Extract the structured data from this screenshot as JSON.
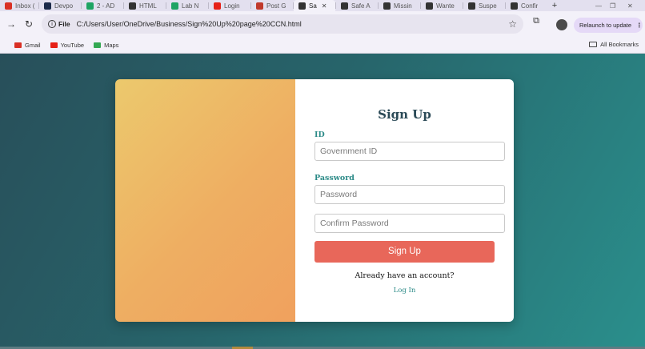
{
  "browser": {
    "tabs": [
      {
        "label": "Inbox (",
        "icon": "gmail-icon",
        "color": "#d93025"
      },
      {
        "label": "Devpo",
        "icon": "devpost-icon",
        "color": "#1b2a4a"
      },
      {
        "label": "2 - AD",
        "icon": "drive-icon",
        "color": "#1fa463"
      },
      {
        "label": "HTML",
        "icon": "chatgpt-icon",
        "color": "#333333"
      },
      {
        "label": "Lab N",
        "icon": "drive-icon",
        "color": "#1fa463"
      },
      {
        "label": "Login",
        "icon": "youtube-icon",
        "color": "#e62117"
      },
      {
        "label": "Post G",
        "icon": "flag-icon",
        "color": "#c0392b"
      },
      {
        "label": "Sa",
        "icon": "chatgpt-icon",
        "color": "#333333",
        "active": true
      },
      {
        "label": "Safe A",
        "icon": "chatgpt-icon",
        "color": "#333333"
      },
      {
        "label": "Missin",
        "icon": "chatgpt-icon",
        "color": "#333333"
      },
      {
        "label": "Wante",
        "icon": "chatgpt-icon",
        "color": "#333333"
      },
      {
        "label": "Suspe",
        "icon": "chatgpt-icon",
        "color": "#333333"
      },
      {
        "label": "Confir",
        "icon": "chatgpt-icon",
        "color": "#333333"
      }
    ],
    "close_glyph": "✕",
    "new_tab_glyph": "+",
    "window_controls": {
      "minimize": "—",
      "restore": "❐",
      "close": "✕"
    },
    "scheme": "File",
    "url": "C:/Users/User/OneDrive/Business/Sign%20Up%20page%20CCN.html",
    "relaunch_label": "Relaunch to update",
    "relaunch_menu": "⋮",
    "bookmarks": [
      {
        "label": "Gmail",
        "icon": "gmail-icon",
        "color": "#d93025"
      },
      {
        "label": "YouTube",
        "icon": "youtube-icon",
        "color": "#e62117"
      },
      {
        "label": "Maps",
        "icon": "maps-pin-icon",
        "color": "#34a853"
      }
    ],
    "all_bookmarks_label": "All Bookmarks"
  },
  "signup": {
    "title": "Sign Up",
    "id_label": "ID",
    "id_placeholder": "Government ID",
    "password_label": "Password",
    "password_placeholder": "Password",
    "confirm_placeholder": "Confirm Password",
    "submit_label": "Sign Up",
    "account_prompt": "Already have an account?",
    "login_link": "Log In"
  },
  "colors": {
    "background_start": "#284f5a",
    "background_end": "#2a8f8c",
    "panel_gradient_start": "#ecc96d",
    "panel_gradient_end": "#f0a15e",
    "accent_button": "#e8675a",
    "label_teal": "#2b8a87",
    "title_dark": "#2b4a57"
  }
}
